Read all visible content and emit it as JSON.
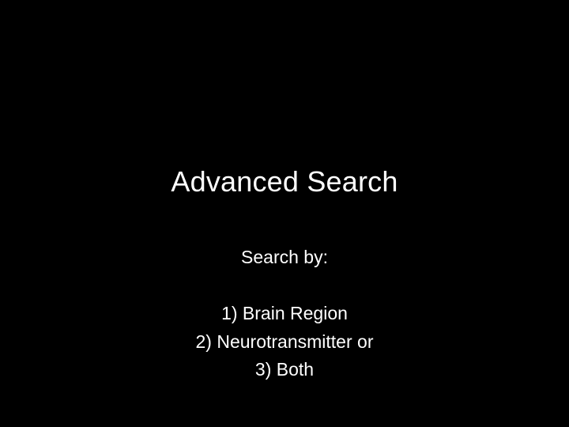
{
  "slide": {
    "title": "Advanced Search",
    "subtitle": "Search by:",
    "options": [
      "1) Brain Region",
      "2) Neurotransmitter or",
      "3) Both"
    ]
  }
}
